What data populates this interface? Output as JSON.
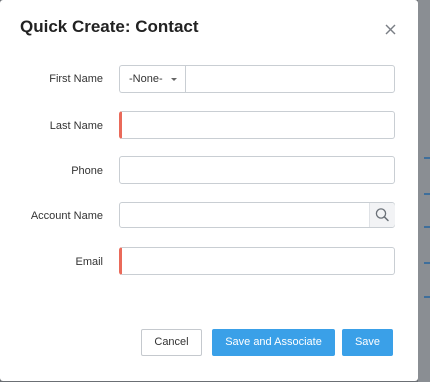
{
  "dialog": {
    "title": "Quick Create: Contact",
    "close_icon": "close-icon"
  },
  "form": {
    "first_name": {
      "label": "First Name",
      "salutation_value": "-None-",
      "value": "",
      "required": false
    },
    "last_name": {
      "label": "Last Name",
      "value": "",
      "required": true
    },
    "phone": {
      "label": "Phone",
      "value": "",
      "required": false
    },
    "account_name": {
      "label": "Account Name",
      "value": "",
      "required": false,
      "lookup_icon": "search-icon"
    },
    "email": {
      "label": "Email",
      "value": "",
      "required": true
    }
  },
  "actions": {
    "cancel_label": "Cancel",
    "save_and_associate_label": "Save and Associate",
    "save_label": "Save"
  },
  "colors": {
    "primary": "#3aa0e8",
    "required_marker": "#ea6a5a",
    "border": "#c9ced3"
  }
}
